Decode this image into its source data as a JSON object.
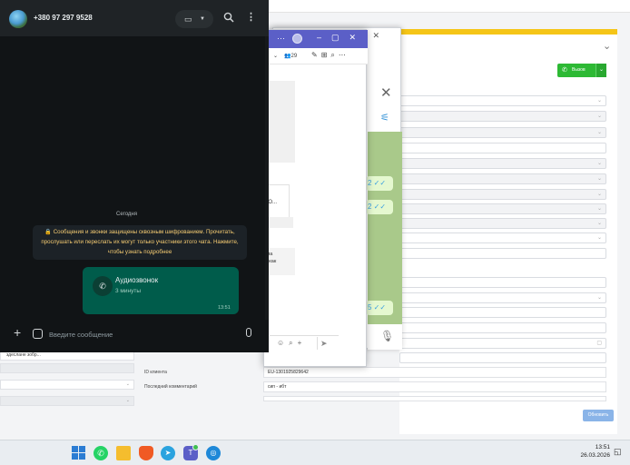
{
  "whatsapp": {
    "phone": "+380 97 297 9528",
    "date_chip": "Сегодня",
    "encryption_notice": "🔒 Сообщения и звонки защищены сквозным шифрованием. Прочитать, прослушать или переслать их могут только участники этого чата. Нажмите, чтобы узнать подробнее",
    "call_bubble": {
      "title": "Аудиозвонок",
      "duration": "3 минуты",
      "time": "13:51"
    },
    "input_placeholder": "Введите сообщение",
    "icons": {
      "video": "video-camera-icon",
      "search": "search-icon",
      "menu": "more-vertical-icon",
      "attach": "plus-icon",
      "sticker": "sticker-icon",
      "mic": "microphone-icon",
      "call_type": "incoming-call-icon"
    },
    "colors": {
      "bubble": "#005c4b",
      "notice_text": "#f7cd73",
      "background": "#111416"
    }
  },
  "teams": {
    "badge_count": "29",
    "card_fragment": "CO...",
    "message_fragment_1": "ила",
    "message_fragment_2": "у, как",
    "accent": "#5b5fc7"
  },
  "telegram": {
    "bubble_fragments": [
      "2 ✓✓",
      "2 ✓✓",
      "5 ✓✓"
    ],
    "chat_color": "#a9c98a"
  },
  "crm": {
    "call_button_label": "Вызов",
    "client_id_label": "ID клиента",
    "client_id_value": "EU-1301925829642",
    "last_comment_label": "Последний комментарий",
    "last_comment_value": "сип - ибт",
    "left_fragment": "здеслане зобр...",
    "save_button_label": "Обновить",
    "accent": "#2db934"
  },
  "taskbar": {
    "time": "13:51",
    "date": "26.03.2026",
    "apps": [
      "windows-start-icon",
      "whatsapp-icon",
      "file-explorer-icon",
      "brave-browser-icon",
      "telegram-icon",
      "teams-icon",
      "globe-browser-icon"
    ]
  }
}
